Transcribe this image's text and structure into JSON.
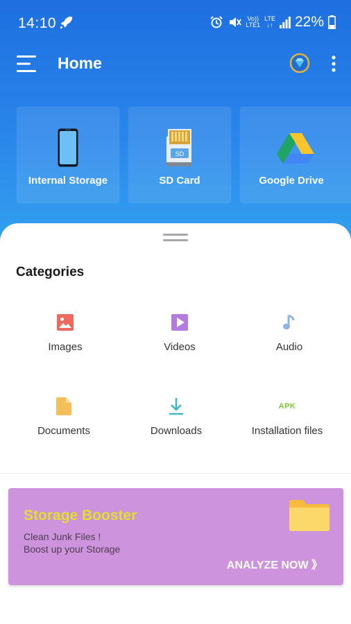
{
  "status_bar": {
    "time": "14:10",
    "volte_top": "Vo))",
    "volte_bottom": "LTE1",
    "lte_top": "LTE",
    "lte_bottom": "↓↑",
    "battery": "22%"
  },
  "app_bar": {
    "title": "Home"
  },
  "storage_cards": [
    {
      "label": "Internal Storage",
      "icon": "phone-icon"
    },
    {
      "label": "SD Card",
      "icon": "sd-card-icon",
      "badge": "SD"
    },
    {
      "label": "Google Drive",
      "icon": "google-drive-icon"
    }
  ],
  "categories": {
    "title": "Categories",
    "items": [
      {
        "label": "Images",
        "icon": "image-icon"
      },
      {
        "label": "Videos",
        "icon": "video-icon"
      },
      {
        "label": "Audio",
        "icon": "music-note-icon"
      },
      {
        "label": "Documents",
        "icon": "document-icon"
      },
      {
        "label": "Downloads",
        "icon": "download-icon"
      },
      {
        "label": "Installation files",
        "icon": "apk-icon",
        "icon_text": "APK"
      }
    ]
  },
  "booster": {
    "title": "Storage Booster",
    "line1": "Clean Junk Files !",
    "line2": "Boost up your Storage",
    "action": "ANALYZE NOW 》"
  },
  "colors": {
    "header_top": "#1e6fe0",
    "header_bottom": "#33a3f0",
    "booster_bg": "#cd94dd",
    "booster_title": "#e1df2d",
    "apk_green": "#7cc934"
  }
}
